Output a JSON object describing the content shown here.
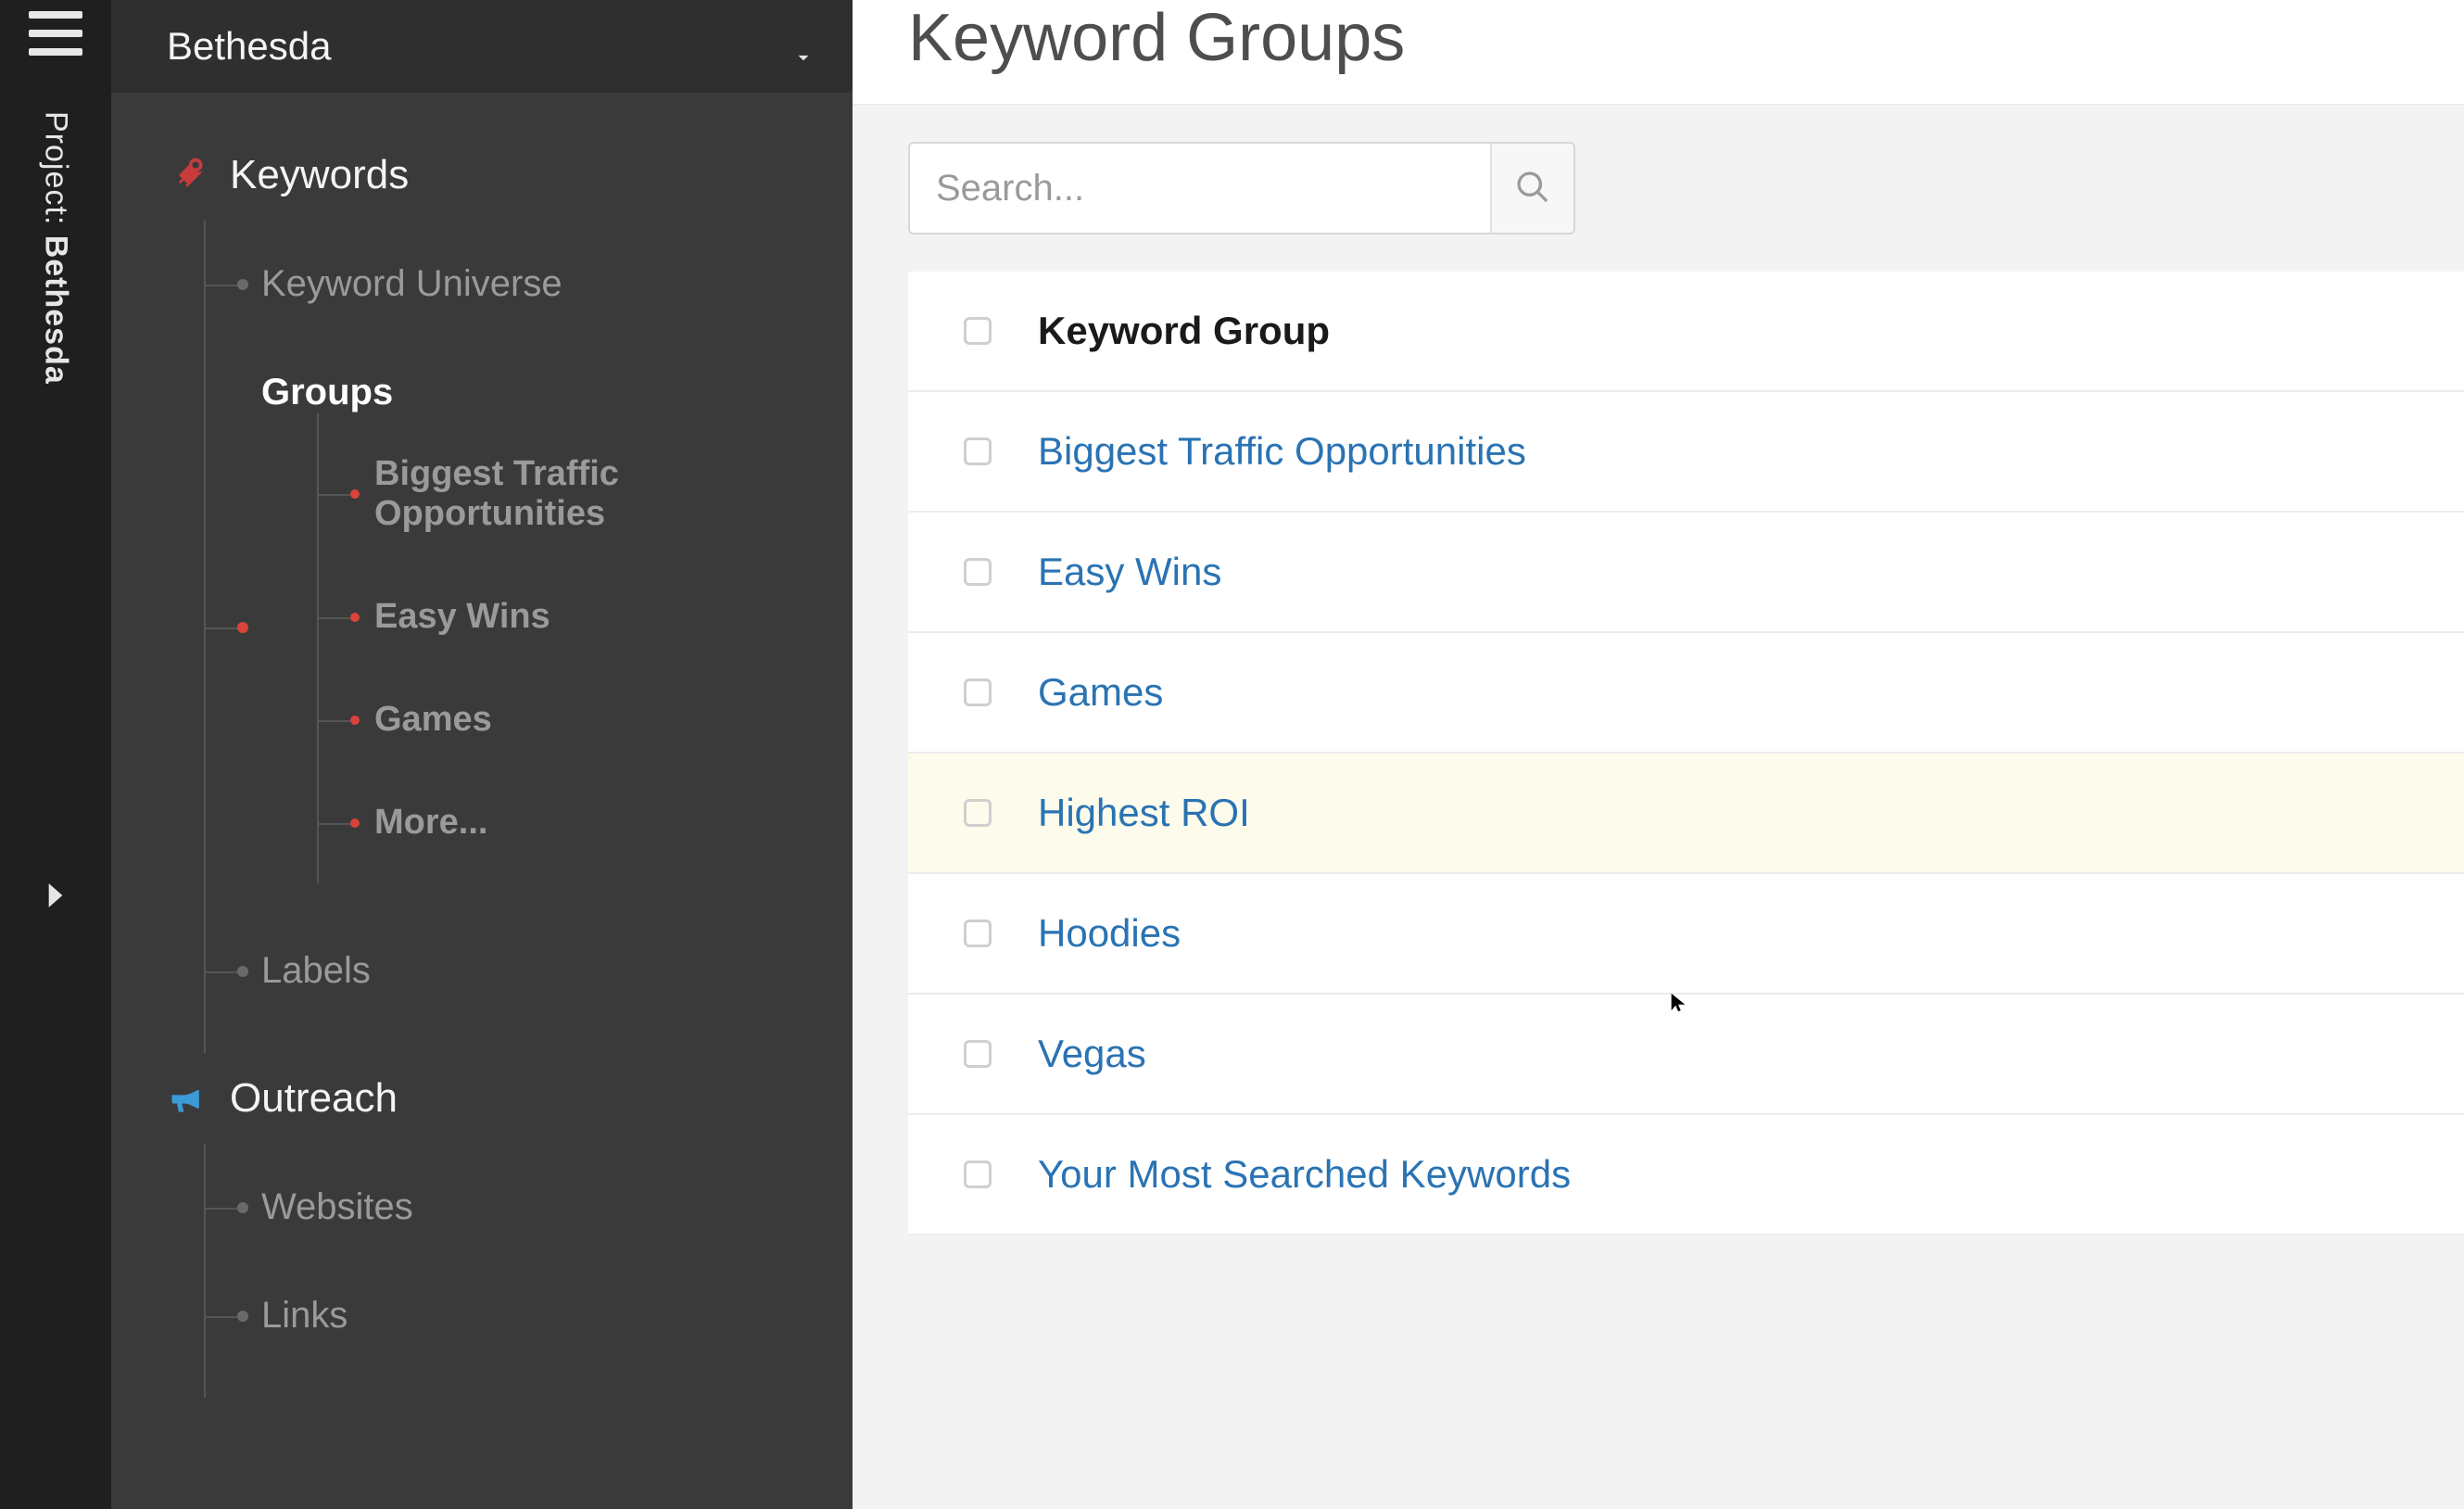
{
  "rail": {
    "project_label": "Project:",
    "project_name": "Bethesda"
  },
  "sidebar": {
    "project_selected": "Bethesda",
    "sections": [
      {
        "id": "keywords",
        "label": "Keywords",
        "items": [
          {
            "label": "Keyword Universe",
            "selected": false
          },
          {
            "label": "Groups",
            "selected": true,
            "children": [
              {
                "label": "Biggest Traffic Opportunities"
              },
              {
                "label": "Easy Wins"
              },
              {
                "label": "Games"
              },
              {
                "label": "More..."
              }
            ]
          },
          {
            "label": "Labels",
            "selected": false
          }
        ]
      },
      {
        "id": "outreach",
        "label": "Outreach",
        "items": [
          {
            "label": "Websites",
            "selected": false
          },
          {
            "label": "Links",
            "selected": false
          }
        ]
      }
    ]
  },
  "main": {
    "title": "Keyword Groups",
    "search": {
      "placeholder": "Search..."
    },
    "table": {
      "header": "Keyword Group",
      "rows": [
        {
          "name": "Biggest Traffic Opportunities",
          "highlight": false
        },
        {
          "name": "Easy Wins",
          "highlight": false
        },
        {
          "name": "Games",
          "highlight": false
        },
        {
          "name": "Highest ROI",
          "highlight": true
        },
        {
          "name": "Hoodies",
          "highlight": false
        },
        {
          "name": "Vegas",
          "highlight": false
        },
        {
          "name": "Your Most Searched Keywords",
          "highlight": false
        }
      ]
    }
  }
}
